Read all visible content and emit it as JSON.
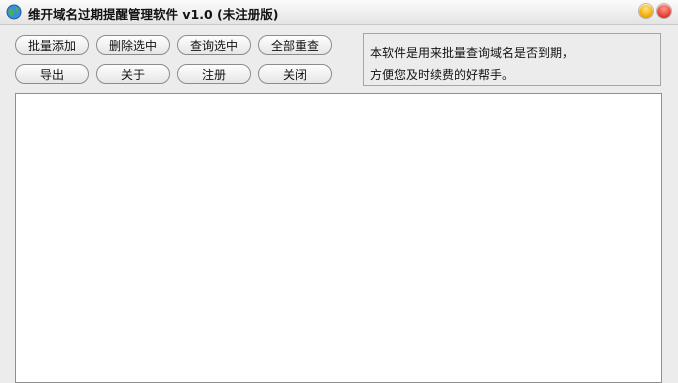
{
  "window": {
    "title": "维开域名过期提醒管理软件 v1.0 (未注册版)"
  },
  "toolbar": {
    "row1": [
      "批量添加",
      "删除选中",
      "查询选中",
      "全部重查"
    ],
    "row2": [
      "导出",
      "关于",
      "注册",
      "关闭"
    ]
  },
  "info": {
    "line1": "本软件是用来批量查询域名是否到期，",
    "line2": "方便您及时续费的好帮手。"
  },
  "colors": {
    "minimize": "#f1a600",
    "close": "#e0392b"
  }
}
